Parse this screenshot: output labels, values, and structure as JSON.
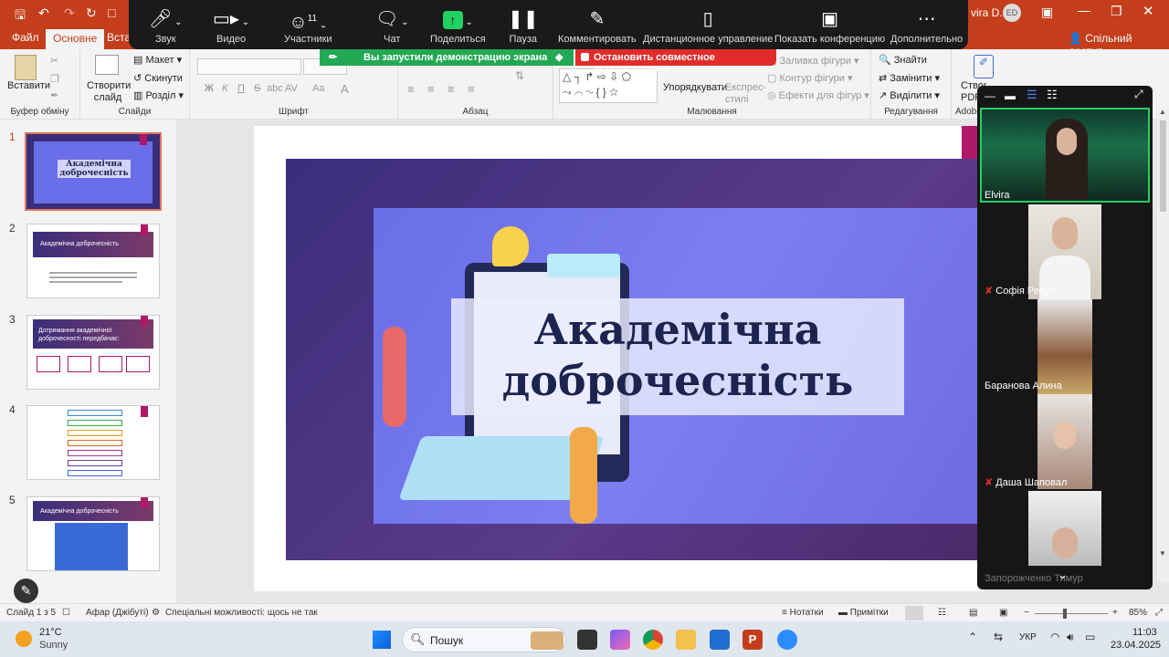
{
  "window": {
    "user_name": "vira D.",
    "user_initials": "ED"
  },
  "ribbon_tabs": [
    {
      "label": "Файл"
    },
    {
      "label": "Основне"
    },
    {
      "label": "Встав"
    }
  ],
  "share_button": "Спільний доступ",
  "ribbon": {
    "clipboard": {
      "paste": "Вставити",
      "label": "Буфер обміну"
    },
    "slides": {
      "new_slide": "Створити слайд",
      "layout": "Макет",
      "reset": "Скинути",
      "section": "Розділ",
      "label": "Слайди"
    },
    "font": {
      "label": "Шрифт",
      "bold": "Ж",
      "italic": "К",
      "underline": "П",
      "strike": "S",
      "abc": "abc",
      "av": "AV",
      "aa": "Aa",
      "color": "A"
    },
    "paragraph": {
      "label": "Абзац"
    },
    "drawing": {
      "arrange": "Упорядкувати",
      "quick_styles": "Експрес-стилі",
      "fill": "Заливка фігури",
      "outline": "Контур фігури",
      "effects": "Ефекти для фігур",
      "label": "Малювання"
    },
    "editing": {
      "find": "Знайти",
      "replace": "Замінити",
      "select": "Виділити",
      "label": "Редагування"
    },
    "adobe": {
      "create_pdf": "Створ PDF",
      "label": "Adobe"
    }
  },
  "zoom_toolbar": [
    {
      "label": "Звук",
      "icon": "microphone-icon"
    },
    {
      "label": "Видео",
      "icon": "camera-icon"
    },
    {
      "label": "Участники",
      "icon": "participants-icon",
      "count": "11"
    },
    {
      "label": "Чат",
      "icon": "chat-icon"
    },
    {
      "label": "Поделиться",
      "icon": "share-screen-icon"
    },
    {
      "label": "Пауза",
      "icon": "pause-icon"
    },
    {
      "label": "Комментировать",
      "icon": "pen-icon"
    },
    {
      "label": "Дистанционное управление",
      "icon": "mouse-icon"
    },
    {
      "label": "Показать конференцию",
      "icon": "person-board-icon"
    },
    {
      "label": "Дополнительно",
      "icon": "more-icon"
    }
  ],
  "share_banner": "Вы запустили демонстрацию экрана",
  "stop_banner": "Остановить совместное использование",
  "thumbnails": [
    {
      "num": "1",
      "title": "Академічна доброчесність"
    },
    {
      "num": "2",
      "title": "Академічна доброчесність"
    },
    {
      "num": "3",
      "title": "Дотримання академічної доброчесності передбачає:"
    },
    {
      "num": "4",
      "title": ""
    },
    {
      "num": "5",
      "title": "Академічна доброчесність"
    }
  ],
  "slide": {
    "title_line1": "Академічна",
    "title_line2": "доброчесність"
  },
  "participants": [
    {
      "name": "Elvira",
      "muted": false
    },
    {
      "name": "Софія Ревун",
      "muted": true
    },
    {
      "name": "Баранова Алина",
      "muted": false
    },
    {
      "name": "Даша Шаповал",
      "muted": true
    },
    {
      "name": "Запорожченко Тимур",
      "muted": false
    }
  ],
  "statusbar": {
    "slide": "Слайд 1 з 5",
    "language": "Афар (Джібуті)",
    "accessibility": "Спеціальні можливості: щось не так",
    "notes": "Нотатки",
    "comments": "Примітки",
    "zoom": "85%"
  },
  "taskbar": {
    "temp": "21°C",
    "weather": "Sunny",
    "search": "Пошук",
    "lang": "УКР",
    "time": "11:03",
    "date": "23.04.2025"
  }
}
